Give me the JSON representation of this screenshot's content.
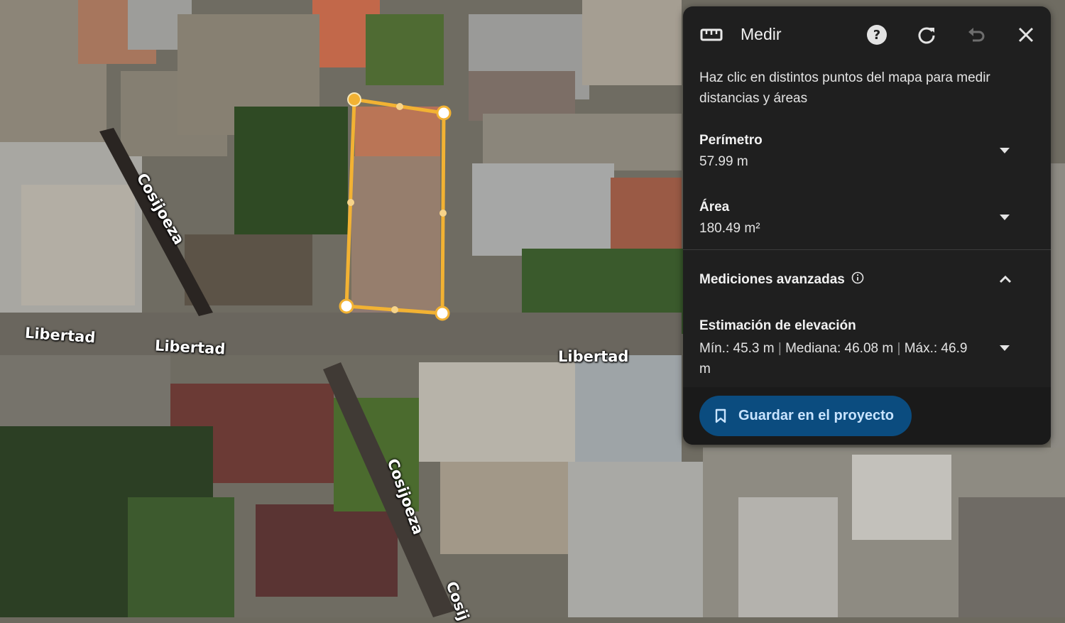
{
  "map": {
    "road_labels": {
      "cosijoeza_1": "Cosijoeza",
      "cosijoeza_2": "Cosijoeza",
      "cosijoeza_3": "Cosij",
      "libertad_1": "Libertad",
      "libertad_2": "Libertad",
      "libertad_3": "Libertad"
    },
    "measure_color": "#f2b233"
  },
  "panel": {
    "title": "Medir",
    "icons": [
      "ruler-icon",
      "help-icon",
      "reset-icon",
      "undo-icon",
      "close-icon"
    ],
    "description": "Haz clic en distintos puntos del mapa para medir distancias y áreas",
    "perimeter": {
      "label": "Perímetro",
      "value": "57.99 m"
    },
    "area": {
      "label": "Área",
      "value": "180.49 m²"
    },
    "advanced": {
      "label": "Mediciones avanzadas"
    },
    "elevation": {
      "label": "Estimación de elevación",
      "min": "Mín.: 45.3 m",
      "median": "Mediana: 46.08 m",
      "max": "Máx.: 46.9 m"
    },
    "save_label": "Guardar en el proyecto",
    "colors": {
      "background": "#1f1f1f",
      "button": "#0b4c7f",
      "button_text": "#c9e4ff"
    }
  }
}
